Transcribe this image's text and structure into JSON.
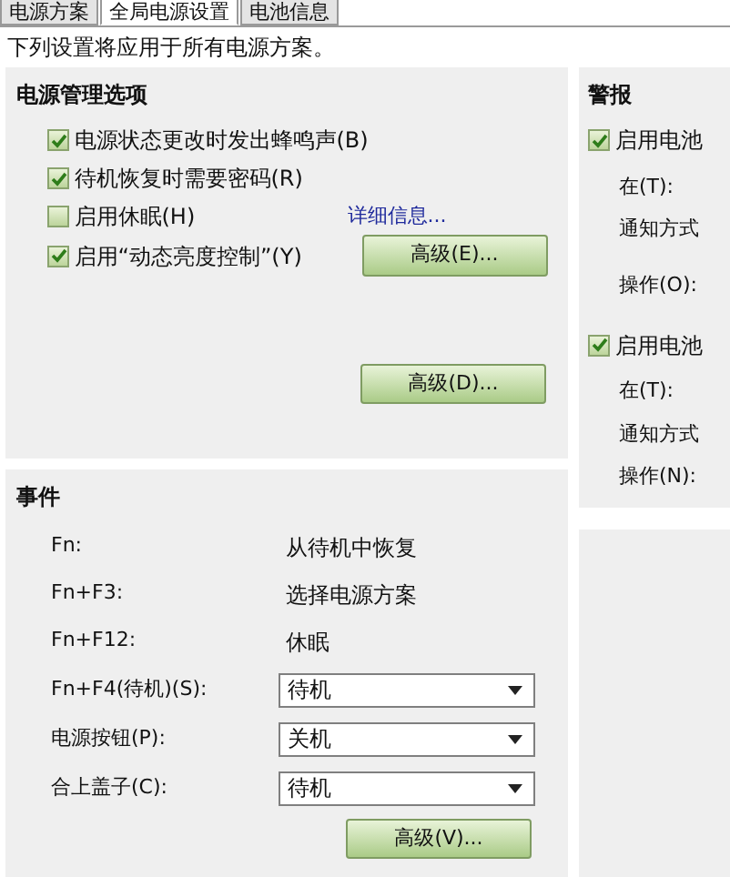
{
  "tabs": [
    {
      "label": "电源方案",
      "selected": false
    },
    {
      "label": "全局电源设置",
      "selected": true
    },
    {
      "label": "电池信息",
      "selected": false
    }
  ],
  "description": "下列设置将应用于所有电源方案。",
  "power_options": {
    "title": "电源管理选项",
    "options": [
      {
        "label": "电源状态更改时发出蜂鸣声(B)",
        "checked": true
      },
      {
        "label": "待机恢复时需要密码(R)",
        "checked": true
      },
      {
        "label": "启用休眠(H)",
        "checked": false,
        "link": "详细信息..."
      },
      {
        "label": "启用“动态亮度控制”(Y)",
        "checked": true,
        "button": "高级(E)..."
      }
    ],
    "button": "高级(D)..."
  },
  "events": {
    "title": "事件",
    "rows": [
      {
        "kind": "text",
        "label": "Fn:",
        "value": "从待机中恢复"
      },
      {
        "kind": "text",
        "label": "Fn+F3:",
        "value": "选择电源方案"
      },
      {
        "kind": "text",
        "label": "Fn+F12:",
        "value": "休眠"
      },
      {
        "kind": "select",
        "label": "Fn+F4(待机)(S):",
        "value": "待机"
      },
      {
        "kind": "select",
        "label": "电源按钮(P):",
        "value": "关机"
      },
      {
        "kind": "select",
        "label": "合上盖子(C):",
        "value": "待机"
      }
    ],
    "button": "高级(V)..."
  },
  "alarms": {
    "title": "警报",
    "groups": [
      {
        "label": "启用电池",
        "checked": true,
        "fields": [
          "在(T):",
          "通知方式",
          "操作(O):"
        ]
      },
      {
        "label": "启用电池",
        "checked": true,
        "fields": [
          "在(T):",
          "通知方式",
          "操作(N):"
        ]
      }
    ]
  }
}
